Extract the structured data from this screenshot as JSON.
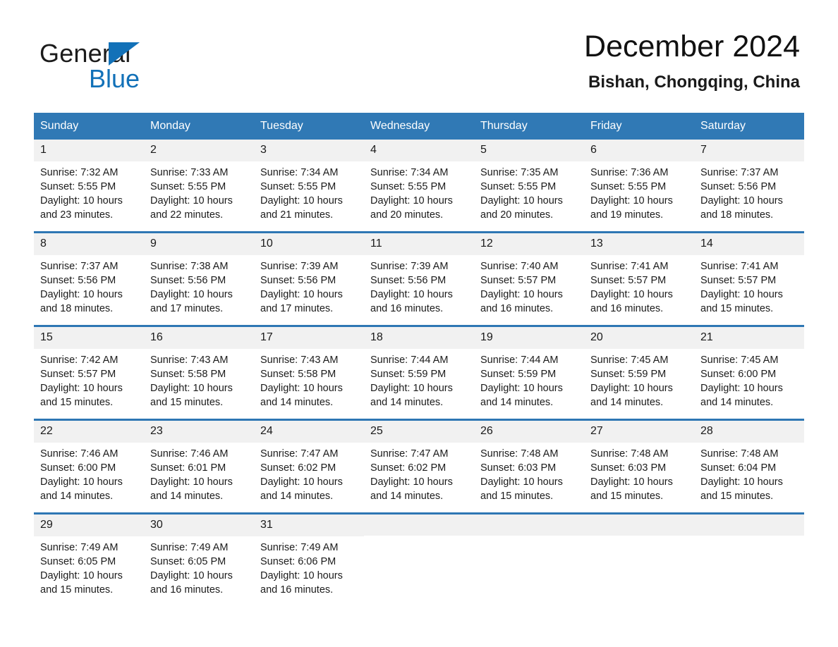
{
  "brand": {
    "name_dark": "General",
    "name_light": "Blue",
    "accent_color": "#1271b8"
  },
  "header": {
    "title": "December 2024",
    "subtitle": "Bishan, Chongqing, China"
  },
  "calendar": {
    "header_bg": "#3079b5",
    "row_divider_color": "#2e77b4",
    "daynumber_bg": "#f1f1f1",
    "weekdays": [
      "Sunday",
      "Monday",
      "Tuesday",
      "Wednesday",
      "Thursday",
      "Friday",
      "Saturday"
    ],
    "weeks": [
      [
        {
          "day": "1",
          "sunrise": "Sunrise: 7:32 AM",
          "sunset": "Sunset: 5:55 PM",
          "daylight_line1": "Daylight: 10 hours",
          "daylight_line2": "and 23 minutes."
        },
        {
          "day": "2",
          "sunrise": "Sunrise: 7:33 AM",
          "sunset": "Sunset: 5:55 PM",
          "daylight_line1": "Daylight: 10 hours",
          "daylight_line2": "and 22 minutes."
        },
        {
          "day": "3",
          "sunrise": "Sunrise: 7:34 AM",
          "sunset": "Sunset: 5:55 PM",
          "daylight_line1": "Daylight: 10 hours",
          "daylight_line2": "and 21 minutes."
        },
        {
          "day": "4",
          "sunrise": "Sunrise: 7:34 AM",
          "sunset": "Sunset: 5:55 PM",
          "daylight_line1": "Daylight: 10 hours",
          "daylight_line2": "and 20 minutes."
        },
        {
          "day": "5",
          "sunrise": "Sunrise: 7:35 AM",
          "sunset": "Sunset: 5:55 PM",
          "daylight_line1": "Daylight: 10 hours",
          "daylight_line2": "and 20 minutes."
        },
        {
          "day": "6",
          "sunrise": "Sunrise: 7:36 AM",
          "sunset": "Sunset: 5:55 PM",
          "daylight_line1": "Daylight: 10 hours",
          "daylight_line2": "and 19 minutes."
        },
        {
          "day": "7",
          "sunrise": "Sunrise: 7:37 AM",
          "sunset": "Sunset: 5:56 PM",
          "daylight_line1": "Daylight: 10 hours",
          "daylight_line2": "and 18 minutes."
        }
      ],
      [
        {
          "day": "8",
          "sunrise": "Sunrise: 7:37 AM",
          "sunset": "Sunset: 5:56 PM",
          "daylight_line1": "Daylight: 10 hours",
          "daylight_line2": "and 18 minutes."
        },
        {
          "day": "9",
          "sunrise": "Sunrise: 7:38 AM",
          "sunset": "Sunset: 5:56 PM",
          "daylight_line1": "Daylight: 10 hours",
          "daylight_line2": "and 17 minutes."
        },
        {
          "day": "10",
          "sunrise": "Sunrise: 7:39 AM",
          "sunset": "Sunset: 5:56 PM",
          "daylight_line1": "Daylight: 10 hours",
          "daylight_line2": "and 17 minutes."
        },
        {
          "day": "11",
          "sunrise": "Sunrise: 7:39 AM",
          "sunset": "Sunset: 5:56 PM",
          "daylight_line1": "Daylight: 10 hours",
          "daylight_line2": "and 16 minutes."
        },
        {
          "day": "12",
          "sunrise": "Sunrise: 7:40 AM",
          "sunset": "Sunset: 5:57 PM",
          "daylight_line1": "Daylight: 10 hours",
          "daylight_line2": "and 16 minutes."
        },
        {
          "day": "13",
          "sunrise": "Sunrise: 7:41 AM",
          "sunset": "Sunset: 5:57 PM",
          "daylight_line1": "Daylight: 10 hours",
          "daylight_line2": "and 16 minutes."
        },
        {
          "day": "14",
          "sunrise": "Sunrise: 7:41 AM",
          "sunset": "Sunset: 5:57 PM",
          "daylight_line1": "Daylight: 10 hours",
          "daylight_line2": "and 15 minutes."
        }
      ],
      [
        {
          "day": "15",
          "sunrise": "Sunrise: 7:42 AM",
          "sunset": "Sunset: 5:57 PM",
          "daylight_line1": "Daylight: 10 hours",
          "daylight_line2": "and 15 minutes."
        },
        {
          "day": "16",
          "sunrise": "Sunrise: 7:43 AM",
          "sunset": "Sunset: 5:58 PM",
          "daylight_line1": "Daylight: 10 hours",
          "daylight_line2": "and 15 minutes."
        },
        {
          "day": "17",
          "sunrise": "Sunrise: 7:43 AM",
          "sunset": "Sunset: 5:58 PM",
          "daylight_line1": "Daylight: 10 hours",
          "daylight_line2": "and 14 minutes."
        },
        {
          "day": "18",
          "sunrise": "Sunrise: 7:44 AM",
          "sunset": "Sunset: 5:59 PM",
          "daylight_line1": "Daylight: 10 hours",
          "daylight_line2": "and 14 minutes."
        },
        {
          "day": "19",
          "sunrise": "Sunrise: 7:44 AM",
          "sunset": "Sunset: 5:59 PM",
          "daylight_line1": "Daylight: 10 hours",
          "daylight_line2": "and 14 minutes."
        },
        {
          "day": "20",
          "sunrise": "Sunrise: 7:45 AM",
          "sunset": "Sunset: 5:59 PM",
          "daylight_line1": "Daylight: 10 hours",
          "daylight_line2": "and 14 minutes."
        },
        {
          "day": "21",
          "sunrise": "Sunrise: 7:45 AM",
          "sunset": "Sunset: 6:00 PM",
          "daylight_line1": "Daylight: 10 hours",
          "daylight_line2": "and 14 minutes."
        }
      ],
      [
        {
          "day": "22",
          "sunrise": "Sunrise: 7:46 AM",
          "sunset": "Sunset: 6:00 PM",
          "daylight_line1": "Daylight: 10 hours",
          "daylight_line2": "and 14 minutes."
        },
        {
          "day": "23",
          "sunrise": "Sunrise: 7:46 AM",
          "sunset": "Sunset: 6:01 PM",
          "daylight_line1": "Daylight: 10 hours",
          "daylight_line2": "and 14 minutes."
        },
        {
          "day": "24",
          "sunrise": "Sunrise: 7:47 AM",
          "sunset": "Sunset: 6:02 PM",
          "daylight_line1": "Daylight: 10 hours",
          "daylight_line2": "and 14 minutes."
        },
        {
          "day": "25",
          "sunrise": "Sunrise: 7:47 AM",
          "sunset": "Sunset: 6:02 PM",
          "daylight_line1": "Daylight: 10 hours",
          "daylight_line2": "and 14 minutes."
        },
        {
          "day": "26",
          "sunrise": "Sunrise: 7:48 AM",
          "sunset": "Sunset: 6:03 PM",
          "daylight_line1": "Daylight: 10 hours",
          "daylight_line2": "and 15 minutes."
        },
        {
          "day": "27",
          "sunrise": "Sunrise: 7:48 AM",
          "sunset": "Sunset: 6:03 PM",
          "daylight_line1": "Daylight: 10 hours",
          "daylight_line2": "and 15 minutes."
        },
        {
          "day": "28",
          "sunrise": "Sunrise: 7:48 AM",
          "sunset": "Sunset: 6:04 PM",
          "daylight_line1": "Daylight: 10 hours",
          "daylight_line2": "and 15 minutes."
        }
      ],
      [
        {
          "day": "29",
          "sunrise": "Sunrise: 7:49 AM",
          "sunset": "Sunset: 6:05 PM",
          "daylight_line1": "Daylight: 10 hours",
          "daylight_line2": "and 15 minutes."
        },
        {
          "day": "30",
          "sunrise": "Sunrise: 7:49 AM",
          "sunset": "Sunset: 6:05 PM",
          "daylight_line1": "Daylight: 10 hours",
          "daylight_line2": "and 16 minutes."
        },
        {
          "day": "31",
          "sunrise": "Sunrise: 7:49 AM",
          "sunset": "Sunset: 6:06 PM",
          "daylight_line1": "Daylight: 10 hours",
          "daylight_line2": "and 16 minutes."
        },
        {
          "day": "",
          "sunrise": "",
          "sunset": "",
          "daylight_line1": "",
          "daylight_line2": ""
        },
        {
          "day": "",
          "sunrise": "",
          "sunset": "",
          "daylight_line1": "",
          "daylight_line2": ""
        },
        {
          "day": "",
          "sunrise": "",
          "sunset": "",
          "daylight_line1": "",
          "daylight_line2": ""
        },
        {
          "day": "",
          "sunrise": "",
          "sunset": "",
          "daylight_line1": "",
          "daylight_line2": ""
        }
      ]
    ]
  }
}
